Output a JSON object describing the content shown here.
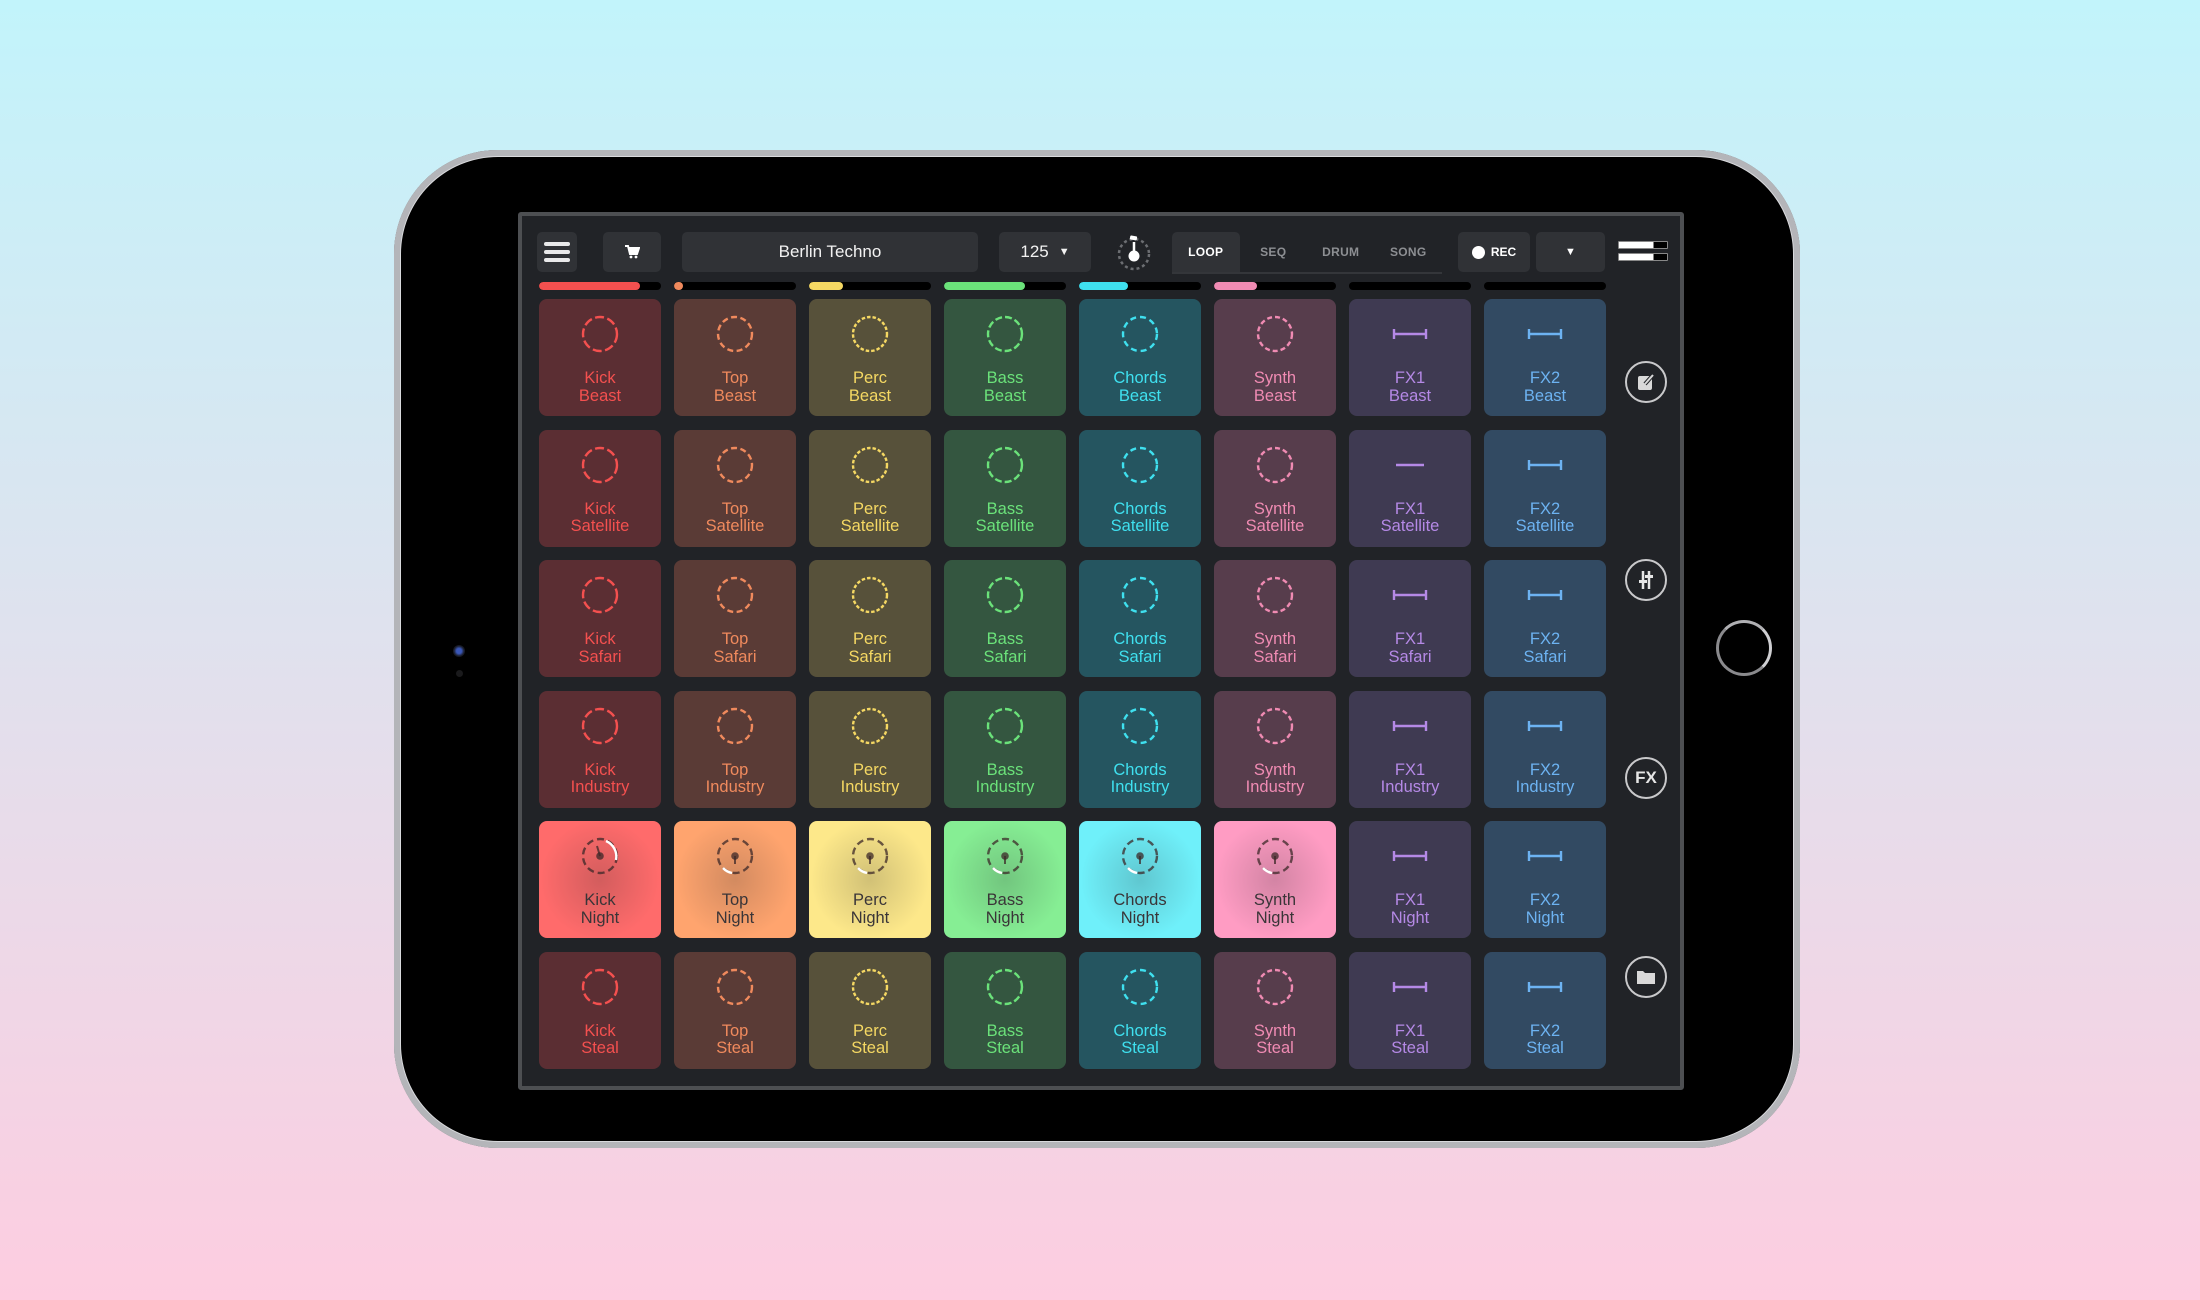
{
  "device": {
    "frame": "tablet",
    "camera_icon": "camera-icon",
    "home_button_icon": "home-button"
  },
  "toolbar": {
    "menu_icon": "hamburger-menu-icon",
    "cart_icon": "shopping-cart-icon",
    "preset_name": "Berlin Techno",
    "tempo": "125",
    "tempo_dropdown_icon": "triangle-down-icon",
    "metronome_icon": "metronome-knob-icon",
    "modes": [
      {
        "label": "LOOP",
        "active": true
      },
      {
        "label": "SEQ",
        "active": false
      },
      {
        "label": "DRUM",
        "active": false
      },
      {
        "label": "SONG",
        "active": false
      }
    ],
    "rec_label": "REC",
    "rec_icon": "record-dot-icon",
    "more_dropdown_icon": "triangle-down-icon",
    "layers_icon": "layers-icon"
  },
  "columns": [
    {
      "name": "Kick",
      "color": "#f4504f",
      "dark": "#5b2e33",
      "light": "#ff6b6b",
      "icon": "dashed-circle-icon",
      "progress": 0.83
    },
    {
      "name": "Top",
      "color": "#f08a5d",
      "dark": "#5a3b36",
      "light": "#ffa46e",
      "icon": "dashed-circle-icon",
      "progress": 0.06
    },
    {
      "name": "Perc",
      "color": "#f5d863",
      "dark": "#57513a",
      "light": "#fde88a",
      "icon": "dashed-circle-icon",
      "progress": 0.28
    },
    {
      "name": "Bass",
      "color": "#6be27a",
      "dark": "#345640",
      "light": "#86ee94",
      "icon": "dashed-circle-icon",
      "progress": 0.66
    },
    {
      "name": "Chords",
      "color": "#3fe0ef",
      "dark": "#255560",
      "light": "#6ff0fa",
      "icon": "dashed-circle-icon",
      "progress": 0.4
    },
    {
      "name": "Synth",
      "color": "#f08bb3",
      "dark": "#573d4c",
      "light": "#ff9cc3",
      "icon": "dashed-circle-icon",
      "progress": 0.35
    },
    {
      "name": "FX1",
      "color": "#b589e6",
      "dark": "#3f3a52",
      "light": "#3f3a52",
      "icon": "fx-bar-icon",
      "progress": 0
    },
    {
      "name": "FX2",
      "color": "#6db3f2",
      "dark": "#324a62",
      "light": "#324a62",
      "icon": "fx-bar-icon",
      "progress": 0
    }
  ],
  "rows": [
    "Beast",
    "Satellite",
    "Safari",
    "Industry",
    "Night",
    "Steal"
  ],
  "active_row": 4,
  "pads": [
    [
      {
        "l1": "Kick",
        "l2": "Beast"
      },
      {
        "l1": "Top",
        "l2": "Beast"
      },
      {
        "l1": "Perc",
        "l2": "Beast"
      },
      {
        "l1": "Bass",
        "l2": "Beast"
      },
      {
        "l1": "Chords",
        "l2": "Beast"
      },
      {
        "l1": "Synth",
        "l2": "Beast"
      },
      {
        "l1": "FX1",
        "l2": "Beast"
      },
      {
        "l1": "FX2",
        "l2": "Beast"
      }
    ],
    [
      {
        "l1": "Kick",
        "l2": "Satellite"
      },
      {
        "l1": "Top",
        "l2": "Satellite"
      },
      {
        "l1": "Perc",
        "l2": "Satellite"
      },
      {
        "l1": "Bass",
        "l2": "Satellite"
      },
      {
        "l1": "Chords",
        "l2": "Satellite"
      },
      {
        "l1": "Synth",
        "l2": "Satellite"
      },
      {
        "l1": "FX1",
        "l2": "Satellite",
        "plain": true
      },
      {
        "l1": "FX2",
        "l2": "Satellite"
      }
    ],
    [
      {
        "l1": "Kick",
        "l2": "Safari"
      },
      {
        "l1": "Top",
        "l2": "Safari"
      },
      {
        "l1": "Perc",
        "l2": "Safari"
      },
      {
        "l1": "Bass",
        "l2": "Safari"
      },
      {
        "l1": "Chords",
        "l2": "Safari"
      },
      {
        "l1": "Synth",
        "l2": "Safari"
      },
      {
        "l1": "FX1",
        "l2": "Safari"
      },
      {
        "l1": "FX2",
        "l2": "Safari"
      }
    ],
    [
      {
        "l1": "Kick",
        "l2": "Industry"
      },
      {
        "l1": "Top",
        "l2": "Industry"
      },
      {
        "l1": "Perc",
        "l2": "Industry"
      },
      {
        "l1": "Bass",
        "l2": "Industry"
      },
      {
        "l1": "Chords",
        "l2": "Industry"
      },
      {
        "l1": "Synth",
        "l2": "Industry"
      },
      {
        "l1": "FX1",
        "l2": "Industry"
      },
      {
        "l1": "FX2",
        "l2": "Industry"
      }
    ],
    [
      {
        "l1": "Kick",
        "l2": "Night"
      },
      {
        "l1": "Top",
        "l2": "Night"
      },
      {
        "l1": "Perc",
        "l2": "Night"
      },
      {
        "l1": "Bass",
        "l2": "Night"
      },
      {
        "l1": "Chords",
        "l2": "Night"
      },
      {
        "l1": "Synth",
        "l2": "Night"
      },
      {
        "l1": "FX1",
        "l2": "Night"
      },
      {
        "l1": "FX2",
        "l2": "Night"
      }
    ],
    [
      {
        "l1": "Kick",
        "l2": "Steal"
      },
      {
        "l1": "Top",
        "l2": "Steal"
      },
      {
        "l1": "Perc",
        "l2": "Steal"
      },
      {
        "l1": "Bass",
        "l2": "Steal"
      },
      {
        "l1": "Chords",
        "l2": "Steal"
      },
      {
        "l1": "Synth",
        "l2": "Steal"
      },
      {
        "l1": "FX1",
        "l2": "Steal"
      },
      {
        "l1": "FX2",
        "l2": "Steal"
      }
    ]
  ],
  "sidebar": [
    {
      "name": "edit",
      "icon": "edit-pencil-icon"
    },
    {
      "name": "mixer",
      "icon": "mixer-sliders-icon"
    },
    {
      "name": "fx",
      "icon": "fx-icon",
      "label": "FX"
    },
    {
      "name": "library",
      "icon": "folder-icon"
    }
  ]
}
